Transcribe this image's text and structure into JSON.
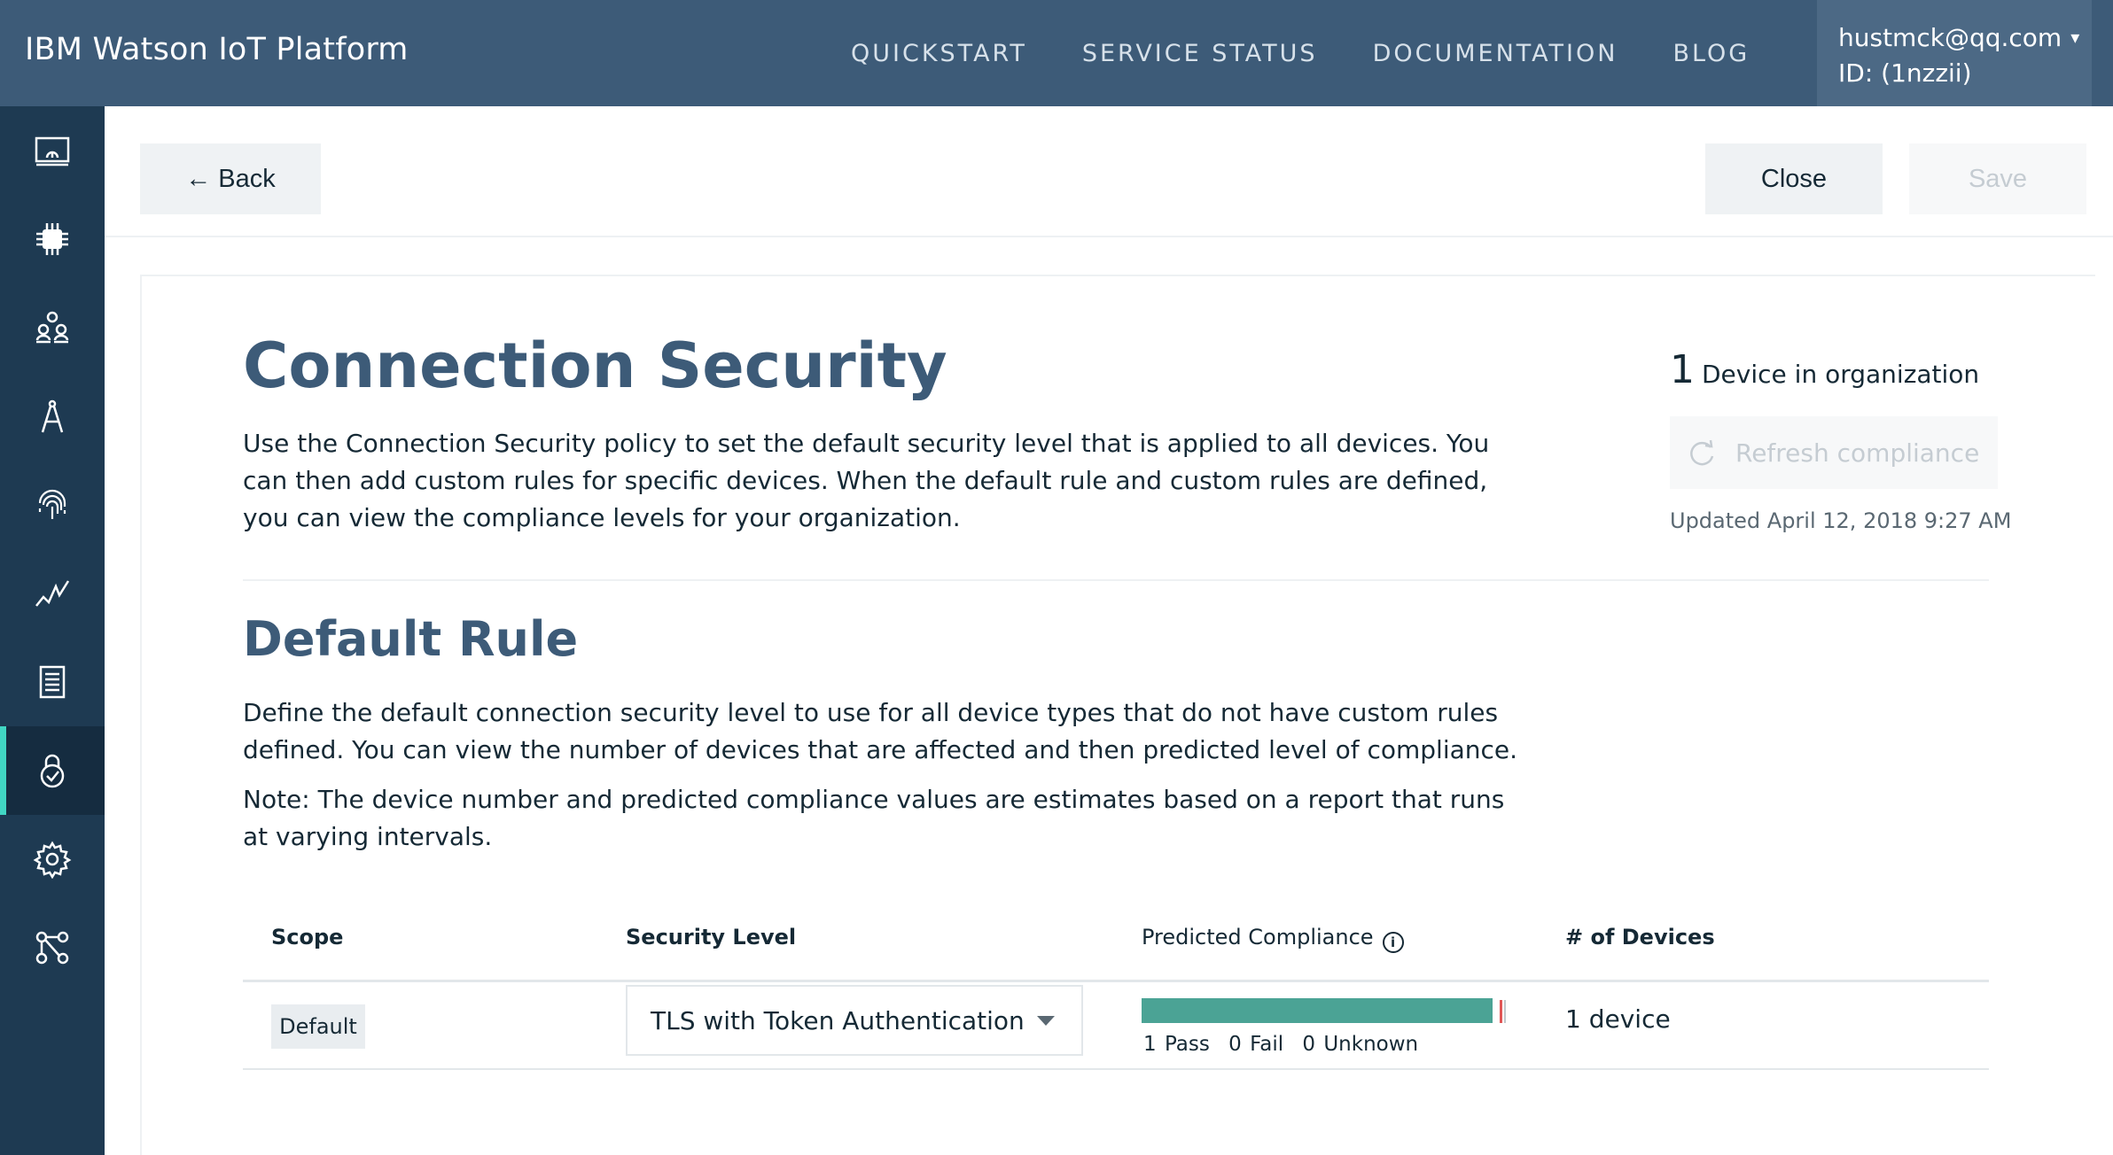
{
  "header": {
    "brand": "IBM Watson IoT Platform",
    "nav": [
      "QUICKSTART",
      "SERVICE STATUS",
      "DOCUMENTATION",
      "BLOG"
    ],
    "user_email": "hustmck@qq.com",
    "user_caret": "▾",
    "org_id": "ID: (1nzzii)"
  },
  "sidebar": {
    "items": [
      {
        "icon": "dashboard-icon"
      },
      {
        "icon": "devices-chip-icon"
      },
      {
        "icon": "members-icon"
      },
      {
        "icon": "apps-compass-icon"
      },
      {
        "icon": "fingerprint-icon"
      },
      {
        "icon": "usage-chart-icon"
      },
      {
        "icon": "logs-document-icon"
      },
      {
        "icon": "security-lock-icon",
        "active": true
      },
      {
        "icon": "settings-gear-icon"
      },
      {
        "icon": "extensions-icon"
      }
    ]
  },
  "actions": {
    "back_label": "← Back",
    "close_label": "Close",
    "save_label": "Save"
  },
  "content": {
    "title": "Connection Security",
    "intro": "Use the Connection Security policy to set the default security level that is applied to all devices. You can then add custom rules for specific devices. When the default rule and custom rules are defined, you can view the compliance levels for your organization.",
    "device_count": "1",
    "device_count_label": "Device in organization",
    "refresh_label": "Refresh compliance",
    "updated": "Updated April 12, 2018 9:27 AM",
    "default_rule_title": "Default Rule",
    "default_rule_desc": "Define the default connection security level to use for all device types that do not have custom rules defined. You can view the number of devices that are affected and then predicted level of compliance.",
    "note": "Note: The device number and predicted compliance values are estimates based on a report that runs at varying intervals."
  },
  "table": {
    "headers": {
      "scope": "Scope",
      "security_level": "Security Level",
      "predicted_compliance": "Predicted Compliance",
      "devices": "# of Devices"
    },
    "row": {
      "scope": "Default",
      "security_level": "TLS with Token Authentication",
      "compliance_pass": "1 Pass",
      "compliance_fail": "0 Fail",
      "compliance_unknown": "0 Unknown",
      "pass_fraction": 0.98,
      "devices": "1 device"
    }
  },
  "colors": {
    "header_bg": "#3d5b78",
    "sidebar_bg": "#1e3a52",
    "accent_active": "#41d6c3",
    "heading": "#3d5b78",
    "pass_bar": "#4ba395",
    "fail_marker": "#e05656"
  }
}
